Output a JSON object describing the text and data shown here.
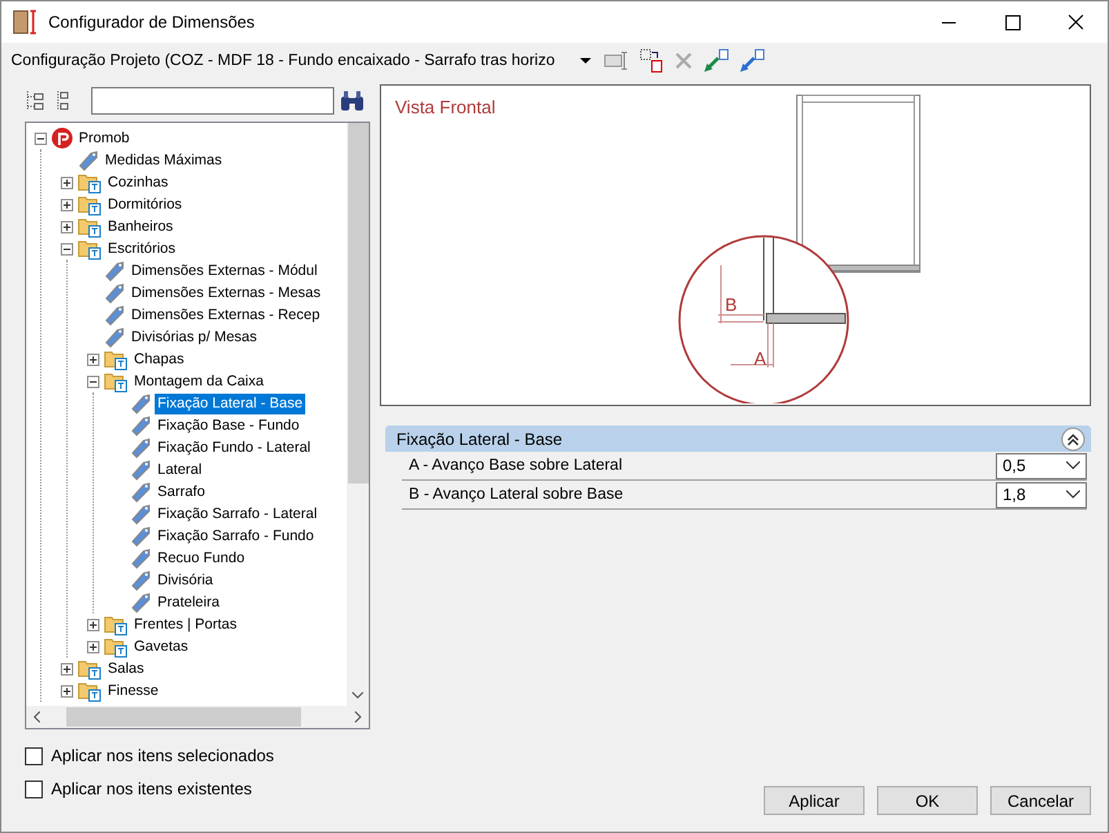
{
  "window": {
    "title": "Configurador de Dimensões"
  },
  "configuration": {
    "value": "Configuração Projeto (COZ - MDF 18 - Fundo encaixado - Sarrafo tras horizo"
  },
  "tree": [
    {
      "label": "Promob",
      "kind": "root",
      "expanded": true,
      "selected": false,
      "children": [
        {
          "label": "Medidas Máximas",
          "kind": "item",
          "selected": false
        },
        {
          "label": "Cozinhas",
          "kind": "folder",
          "expanded": false,
          "selected": false
        },
        {
          "label": "Dormitórios",
          "kind": "folder",
          "expanded": false,
          "selected": false
        },
        {
          "label": "Banheiros",
          "kind": "folder",
          "expanded": false,
          "selected": false
        },
        {
          "label": "Escritórios",
          "kind": "folder",
          "expanded": true,
          "selected": false,
          "children": [
            {
              "label": "Dimensões Externas - Módul",
              "kind": "item",
              "selected": false
            },
            {
              "label": "Dimensões Externas - Mesas",
              "kind": "item",
              "selected": false
            },
            {
              "label": "Dimensões Externas - Recep",
              "kind": "item",
              "selected": false
            },
            {
              "label": "Divisórias p/ Mesas",
              "kind": "item",
              "selected": false
            },
            {
              "label": "Chapas",
              "kind": "folder",
              "expanded": false,
              "selected": false
            },
            {
              "label": "Montagem da Caixa",
              "kind": "folder",
              "expanded": true,
              "selected": false,
              "children": [
                {
                  "label": "Fixação Lateral - Base",
                  "kind": "item",
                  "selected": true
                },
                {
                  "label": "Fixação Base - Fundo",
                  "kind": "item",
                  "selected": false
                },
                {
                  "label": "Fixação Fundo - Lateral",
                  "kind": "item",
                  "selected": false
                },
                {
                  "label": "Lateral",
                  "kind": "item",
                  "selected": false
                },
                {
                  "label": "Sarrafo",
                  "kind": "item",
                  "selected": false
                },
                {
                  "label": "Fixação Sarrafo - Lateral",
                  "kind": "item",
                  "selected": false
                },
                {
                  "label": "Fixação Sarrafo - Fundo",
                  "kind": "item",
                  "selected": false
                },
                {
                  "label": "Recuo Fundo",
                  "kind": "item",
                  "selected": false
                },
                {
                  "label": "Divisória",
                  "kind": "item",
                  "selected": false
                },
                {
                  "label": "Prateleira",
                  "kind": "item",
                  "selected": false
                }
              ]
            },
            {
              "label": "Frentes | Portas",
              "kind": "folder",
              "expanded": false,
              "selected": false
            },
            {
              "label": "Gavetas",
              "kind": "folder",
              "expanded": false,
              "selected": false
            }
          ]
        },
        {
          "label": "Salas",
          "kind": "folder",
          "expanded": false,
          "selected": false
        },
        {
          "label": "Finesse",
          "kind": "folder",
          "expanded": false,
          "selected": false
        }
      ]
    }
  ],
  "preview": {
    "title": "Vista Frontal",
    "label_a": "A",
    "label_b": "B"
  },
  "properties": {
    "group": "Fixação Lateral - Base",
    "expanded": true,
    "rows": [
      {
        "label": "A - Avanço Base sobre Lateral",
        "value": "0,5"
      },
      {
        "label": "B - Avanço Lateral sobre Base",
        "value": "1,8"
      }
    ]
  },
  "options": [
    {
      "label": "Aplicar nos itens selecionados",
      "checked": false
    },
    {
      "label": "Aplicar nos itens existentes",
      "checked": false
    }
  ],
  "buttons": [
    "Aplicar",
    "OK",
    "Cancelar"
  ]
}
